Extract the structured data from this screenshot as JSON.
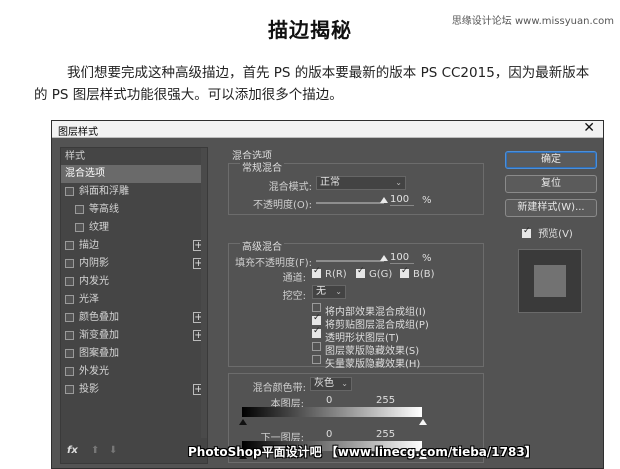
{
  "article": {
    "watermark": "思缘设计论坛 www.missyuan.com",
    "title": "描边揭秘",
    "paragraph": "我们想要完成这种高级描边，首先 PS 的版本要最新的版本 PS CC2015，因为最新版本的 PS 图层样式功能很强大。可以添加很多个描边。"
  },
  "dialog": {
    "title": "图层样式",
    "close_icon": "close-icon",
    "styles_header": "样式",
    "styles": [
      {
        "label": "混合选项",
        "checkbox": false,
        "selected": true,
        "indent": 0,
        "plus": false
      },
      {
        "label": "斜面和浮雕",
        "checkbox": true,
        "checked": false,
        "indent": 0,
        "plus": false
      },
      {
        "label": "等高线",
        "checkbox": true,
        "checked": false,
        "indent": 1,
        "plus": false
      },
      {
        "label": "纹理",
        "checkbox": true,
        "checked": false,
        "indent": 1,
        "plus": false
      },
      {
        "label": "描边",
        "checkbox": true,
        "checked": false,
        "indent": 0,
        "plus": true
      },
      {
        "label": "内阴影",
        "checkbox": true,
        "checked": false,
        "indent": 0,
        "plus": true
      },
      {
        "label": "内发光",
        "checkbox": true,
        "checked": false,
        "indent": 0,
        "plus": false
      },
      {
        "label": "光泽",
        "checkbox": true,
        "checked": false,
        "indent": 0,
        "plus": false
      },
      {
        "label": "颜色叠加",
        "checkbox": true,
        "checked": false,
        "indent": 0,
        "plus": true
      },
      {
        "label": "渐变叠加",
        "checkbox": true,
        "checked": false,
        "indent": 0,
        "plus": true
      },
      {
        "label": "图案叠加",
        "checkbox": true,
        "checked": false,
        "indent": 0,
        "plus": false
      },
      {
        "label": "外发光",
        "checkbox": true,
        "checked": false,
        "indent": 0,
        "plus": false
      },
      {
        "label": "投影",
        "checkbox": true,
        "checked": false,
        "indent": 0,
        "plus": true
      }
    ],
    "footer": {
      "fx": "fx",
      "up_icon": "arrow-up-icon",
      "down_icon": "arrow-down-icon"
    },
    "blend_options_title": "混合选项",
    "general_blending": {
      "title": "常规混合",
      "blend_mode_label": "混合模式:",
      "blend_mode_value": "正常",
      "opacity_label": "不透明度(O):",
      "opacity_value": "100",
      "opacity_unit": "%",
      "opacity_level": 100
    },
    "advanced_blending": {
      "title": "高级混合",
      "fill_opacity_label": "填充不透明度(F):",
      "fill_opacity_value": "100",
      "fill_unit": "%",
      "fill_level": 100,
      "channels_label": "通道:",
      "channel_r": "R(R)",
      "channel_g": "G(G)",
      "channel_b": "B(B)",
      "knockout_label": "挖空:",
      "knockout_value": "无",
      "options": [
        {
          "label": "将内部效果混合成组(I)",
          "checked": false
        },
        {
          "label": "将剪贴图层混合成组(P)",
          "checked": true
        },
        {
          "label": "透明形状图层(T)",
          "checked": true
        },
        {
          "label": "图层蒙版隐藏效果(S)",
          "checked": false
        },
        {
          "label": "矢量蒙版隐藏效果(H)",
          "checked": false
        }
      ]
    },
    "blend_if": {
      "label": "混合颜色带:",
      "value": "灰色",
      "this_layer": "本图层:",
      "this_low": "0",
      "this_high": "255",
      "under_layer": "下一图层:",
      "under_low": "0",
      "under_high": "255"
    },
    "buttons": {
      "ok": "确定",
      "reset": "复位",
      "new_style": "新建样式(W)..."
    },
    "preview_label": "预览(V)",
    "preview_checked": true
  },
  "banner": "PhotoShop平面设计吧 【www.linecg.com/tieba/1783】"
}
